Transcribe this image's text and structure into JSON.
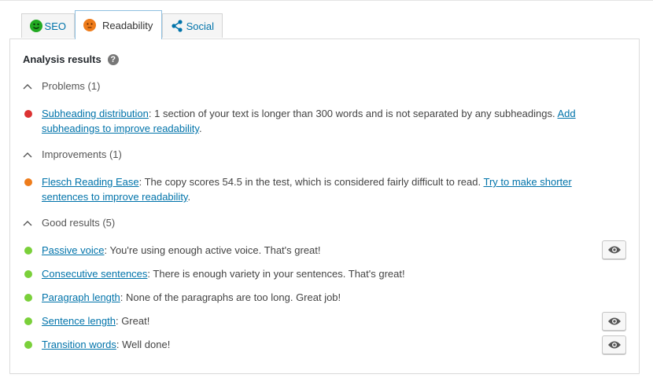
{
  "tabs": [
    {
      "label": "SEO",
      "icon": "smiley-face-icon",
      "color": "#22aa22"
    },
    {
      "label": "Readability",
      "icon": "neutral-face-icon",
      "color": "#ee7c1b",
      "active": true
    },
    {
      "label": "Social",
      "icon": "share-icon",
      "color": "#0073aa"
    }
  ],
  "analysis": {
    "heading": "Analysis results",
    "help_icon": "?",
    "sections": [
      {
        "label": "Problems (1)",
        "items": [
          {
            "color": "#dc3232",
            "link": "Subheading distribution",
            "text": ": 1 section of your text is longer than 300 words and is not separated by any subheadings. ",
            "action_link": "Add subheadings to improve readability",
            "after": "."
          }
        ]
      },
      {
        "label": "Improvements (1)",
        "items": [
          {
            "color": "#ee7c1b",
            "link": "Flesch Reading Ease",
            "text": ": The copy scores 54.5 in the test, which is considered fairly difficult to read. ",
            "action_link": "Try to make shorter sentences to improve readability",
            "after": "."
          }
        ]
      },
      {
        "label": "Good results (5)",
        "items": [
          {
            "color": "#7ad03a",
            "link": "Passive voice",
            "text": ": You're using enough active voice. That's great!",
            "has_eye": true
          },
          {
            "color": "#7ad03a",
            "link": "Consecutive sentences",
            "text": ": There is enough variety in your sentences. That's great!"
          },
          {
            "color": "#7ad03a",
            "link": "Paragraph length",
            "text": ": None of the paragraphs are too long. Great job!"
          },
          {
            "color": "#7ad03a",
            "link": "Sentence length",
            "text": ": Great!",
            "has_eye": true
          },
          {
            "color": "#7ad03a",
            "link": "Transition words",
            "text": ": Well done!",
            "has_eye": true
          }
        ]
      }
    ]
  }
}
